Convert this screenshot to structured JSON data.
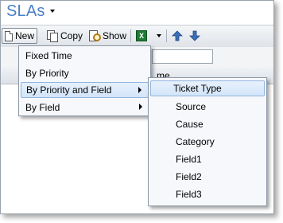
{
  "app": {
    "title": "SLAs"
  },
  "toolbar": {
    "new_label": "New",
    "copy_label": "Copy",
    "show_label": "Show",
    "export_icon": "excel-icon",
    "move_up_icon": "arrow-up-icon",
    "move_down_icon": "arrow-down-icon"
  },
  "grid": {
    "partial_header": "me"
  },
  "new_menu": {
    "items": [
      {
        "label": "Fixed Time",
        "has_submenu": false
      },
      {
        "label": "By Priority",
        "has_submenu": false
      },
      {
        "label": "By Priority and Field",
        "has_submenu": true,
        "highlighted": true
      },
      {
        "label": "By Field",
        "has_submenu": true
      }
    ]
  },
  "field_submenu": {
    "items": [
      {
        "label": "Ticket Type",
        "highlighted": true
      },
      {
        "label": "Source"
      },
      {
        "label": "Cause"
      },
      {
        "label": "Category"
      },
      {
        "label": "Field1"
      },
      {
        "label": "Field2"
      },
      {
        "label": "Field3"
      }
    ]
  },
  "colors": {
    "title": "#4a7fc8",
    "highlight": "#d3e5f9",
    "highlight_border": "#8fb4dd"
  }
}
